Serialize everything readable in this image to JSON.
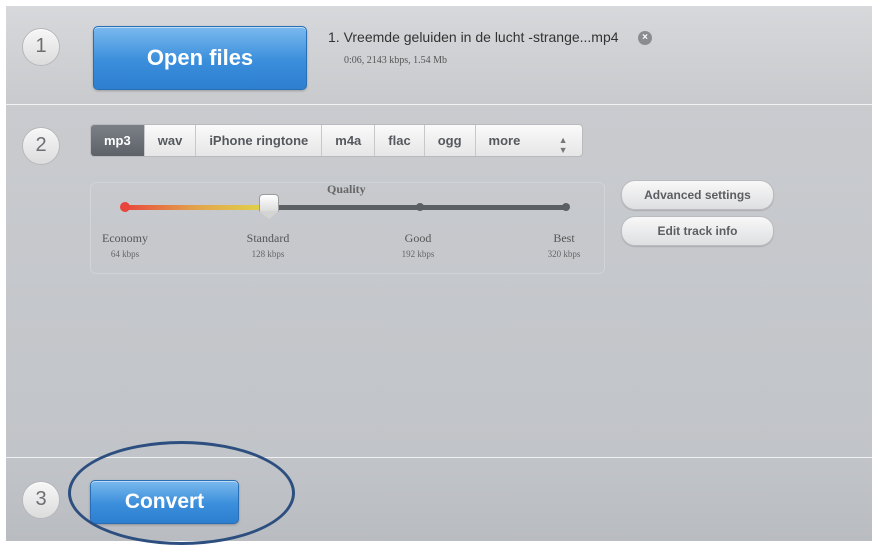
{
  "step1": {
    "number": "1",
    "open_label": "Open files",
    "file": {
      "title": "1. Vreemde geluiden in de lucht -strange...mp4",
      "meta": "0:06, 2143 kbps, 1.54 Mb",
      "remove_icon": "×"
    }
  },
  "step2": {
    "number": "2",
    "formats": [
      "mp3",
      "wav",
      "iPhone ringtone",
      "m4a",
      "flac",
      "ogg"
    ],
    "active_format": "mp3",
    "more_label": "more",
    "quality": {
      "title": "Quality",
      "selected_fraction": 0.33,
      "levels": [
        {
          "name": "Economy",
          "kbps": "64 kbps"
        },
        {
          "name": "Standard",
          "kbps": "128 kbps"
        },
        {
          "name": "Good",
          "kbps": "192 kbps"
        },
        {
          "name": "Best",
          "kbps": "320 kbps"
        }
      ]
    },
    "advanced_label": "Advanced settings",
    "edit_track_label": "Edit track info"
  },
  "step3": {
    "number": "3",
    "convert_label": "Convert"
  },
  "colors": {
    "accent_blue": "#3a8edb",
    "annotation_circle": "#2c4f80",
    "slider_red": "#e8453c",
    "slider_yellow": "#e0d64a"
  }
}
